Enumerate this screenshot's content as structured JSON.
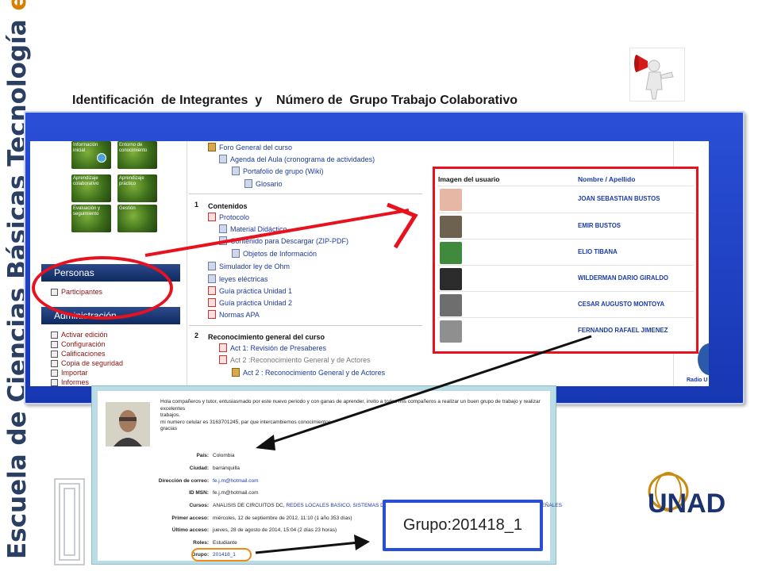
{
  "slide": {
    "vertical_title": {
      "part1": "Escuela de Ciencias ",
      "part2": "Básicas Tecnología ",
      "part3": "e Ingeniería"
    },
    "heading": "Identificación  de Integrantes  y    Número de  Grupo Trabajo Colaborativo"
  },
  "lms": {
    "tiles": [
      {
        "label": "Información inicial"
      },
      {
        "label": "Entorno de conocimiento"
      },
      {
        "label": "Aprendizaje colaborativo"
      },
      {
        "label": "Aprendizaje práctico"
      },
      {
        "label": "Evaluación y seguimiento"
      },
      {
        "label": "Gestión"
      }
    ],
    "personas": {
      "header": "Personas",
      "items": [
        {
          "label": "Participantes"
        }
      ]
    },
    "administracion": {
      "header": "Administración",
      "items": [
        {
          "label": "Activar edición"
        },
        {
          "label": "Configuración"
        },
        {
          "label": "Calificaciones"
        },
        {
          "label": "Copia de seguridad"
        },
        {
          "label": "Importar"
        },
        {
          "label": "Informes"
        }
      ]
    },
    "section0": [
      {
        "label": "Foro General del curso"
      },
      {
        "label": "Agenda del Aula (cronograma de actividades)"
      },
      {
        "label": "Portafolio de grupo (Wiki)"
      },
      {
        "label": "Glosario"
      }
    ],
    "section1": {
      "number": "1",
      "title": "Contenidos",
      "items": [
        {
          "label": "Protocolo"
        },
        {
          "label": "Material Didáctico"
        },
        {
          "label": "Contenido para Descargar (ZIP-PDF)"
        },
        {
          "label": "Objetos de Información"
        },
        {
          "label": "Simulador ley de Ohm"
        },
        {
          "label": "leyes eléctricas"
        },
        {
          "label": "Guía práctica Unidad 1"
        },
        {
          "label": "Guía práctica Unidad 2"
        },
        {
          "label": "Normas APA"
        }
      ]
    },
    "section2": {
      "number": "2",
      "title": "Reconocimiento general del curso",
      "items": [
        {
          "label": "Act 1: Revisión de Presaberes"
        },
        {
          "label": "Act 2 :Reconocimiento General y de Actores"
        },
        {
          "label": "Act 2 : Reconocimiento General y de Actores"
        }
      ]
    },
    "right_band_logo": "Radio U"
  },
  "users_table": {
    "col_image": "Imagen del usuario",
    "col_name": "Nombre / Apellido",
    "rows": [
      {
        "name": "JOAN SEBASTIAN BUSTOS",
        "color": "#e7b7a6"
      },
      {
        "name": "EMIR BUSTOS",
        "color": "#6d6250"
      },
      {
        "name": "ELIO TIBANA",
        "color": "#3f8a3c"
      },
      {
        "name": "WILDERMAN DARIO GIRALDO",
        "color": "#2c2c2c"
      },
      {
        "name": "CESAR AUGUSTO MONTOYA",
        "color": "#6e6e6e"
      },
      {
        "name": "FERNANDO RAFAEL  JIMENEZ",
        "color": "#8f8f8f"
      }
    ]
  },
  "profile": {
    "message_lines": [
      "Hola compañeros y tutor, entusiasmado por este nuevo periodo y con ganas de aprender, invito a todos mis compañeros a realizar un buen grupo de trabajo y realizar excelentes",
      "trabajos.",
      "mi numero celular es 3163701245, par que intercambiemos conocimientos",
      "gracias"
    ],
    "fields": [
      {
        "label": "País:",
        "value": "Colombia",
        "link": false
      },
      {
        "label": "Ciudad:",
        "value": "barranquilla",
        "link": false
      },
      {
        "label": "Dirección de correo:",
        "value": "fe.j.m@hotmail.com",
        "link": true
      },
      {
        "label": "ID MSN:",
        "value": "fe.j.m@hotmail.com",
        "link": false
      },
      {
        "label": "Cursos:",
        "value": "ANALISIS DE CIRCUITOS DC, ",
        "value2": "REDES LOCALES BASICO, SISTEMAS DIGITALES SECUENCIALES, PROCESAMIENTO ANALOGICO DE SEÑALES",
        "link": false
      },
      {
        "label": "Primer acceso:",
        "value": "miércoles, 12 de septiembre de 2012, 11:10  (1 año 353 días)",
        "link": false
      },
      {
        "label": "Último acceso:",
        "value": "jueves, 28 de agosto de 2014, 15:04  (2 días 23 horas)",
        "link": false
      },
      {
        "label": "Roles:",
        "value": "Estudiante",
        "link": false
      },
      {
        "label": "Grupo:",
        "value": "201418_1",
        "link": true
      }
    ]
  },
  "callout": {
    "text": "Grupo:201418_1"
  },
  "logo": {
    "text": "UNAD"
  },
  "colors": {
    "accent_blue": "#2a4fd6",
    "highlight_red": "#e8121e",
    "orange": "#f08a1a"
  }
}
